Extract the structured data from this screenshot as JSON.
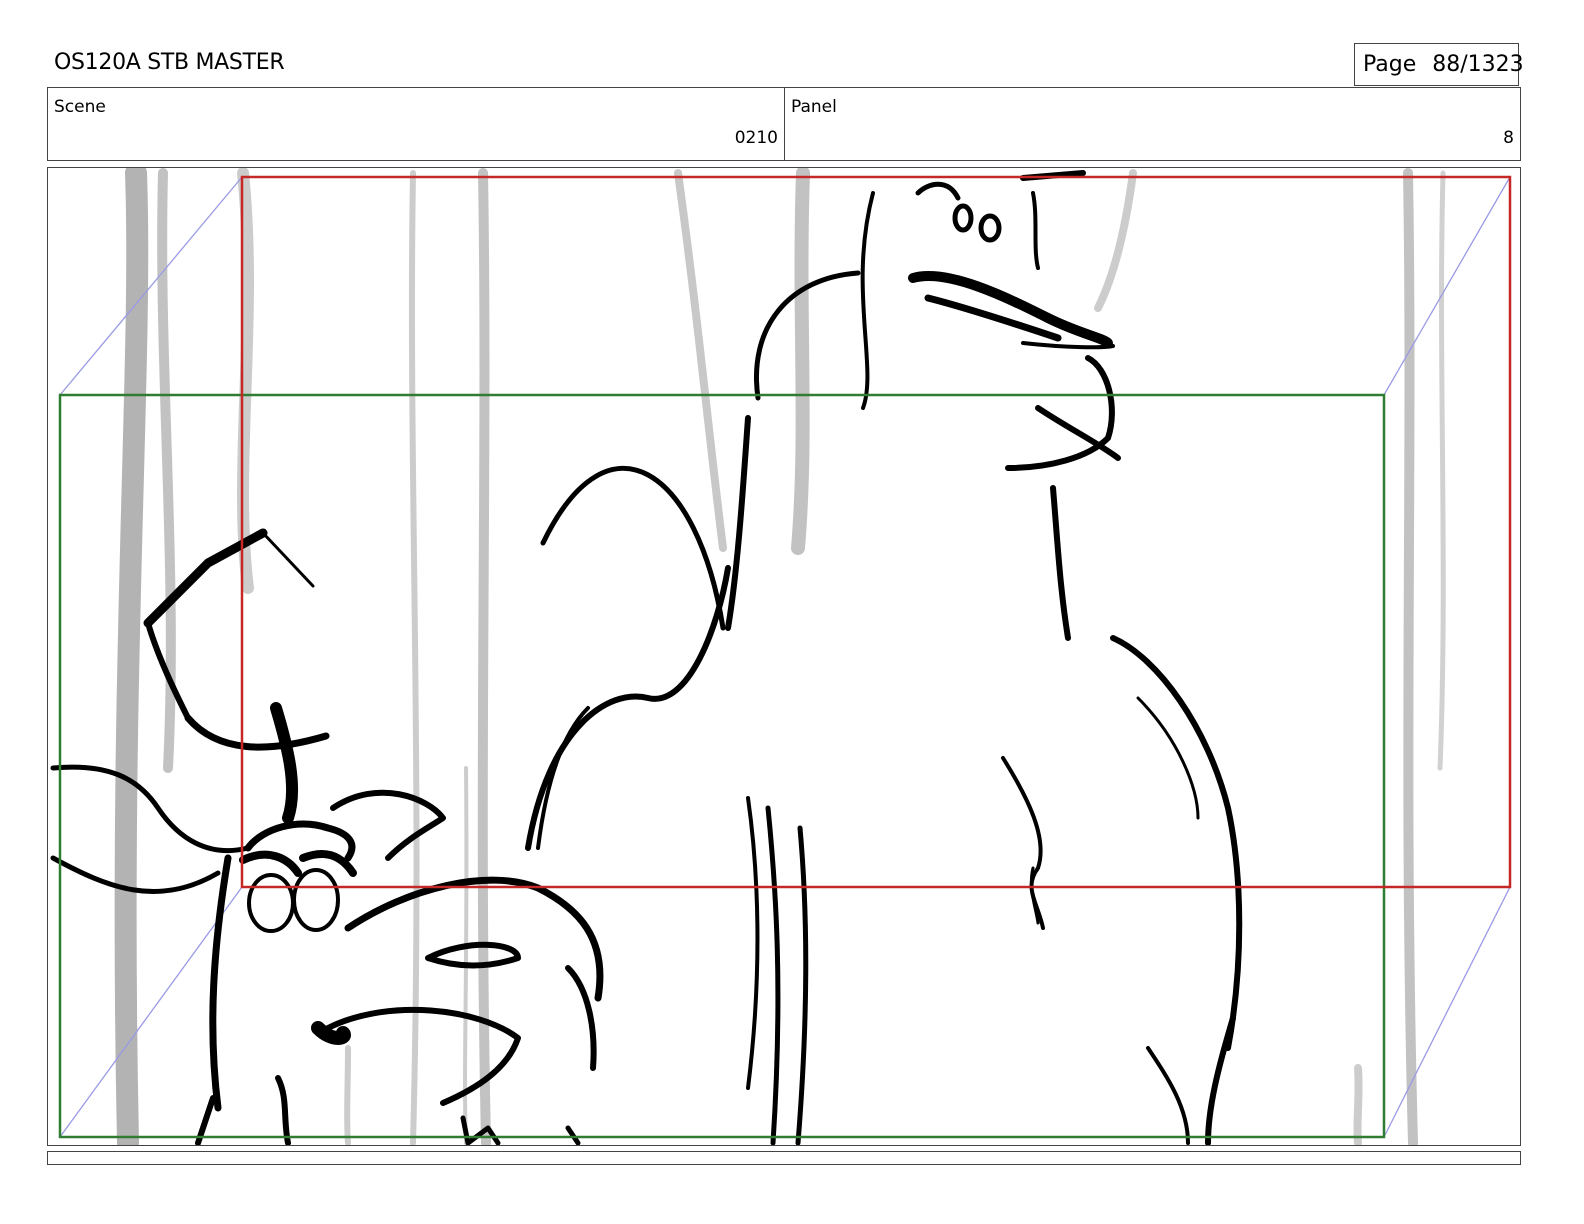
{
  "header": {
    "title": "OS120A STB MASTER",
    "page_label": "Page",
    "page_number": "88/1323"
  },
  "info": {
    "scene_label": "Scene",
    "scene_value": "0210",
    "panel_label": "Panel",
    "panel_value": "8"
  },
  "drawing": {
    "camera_start_color": "#2e7d32",
    "camera_end_color": "#c62828",
    "guide_color": "#9a9ae6",
    "sketch_color": "#000000",
    "background_tree_color": "#9a9a9a"
  }
}
